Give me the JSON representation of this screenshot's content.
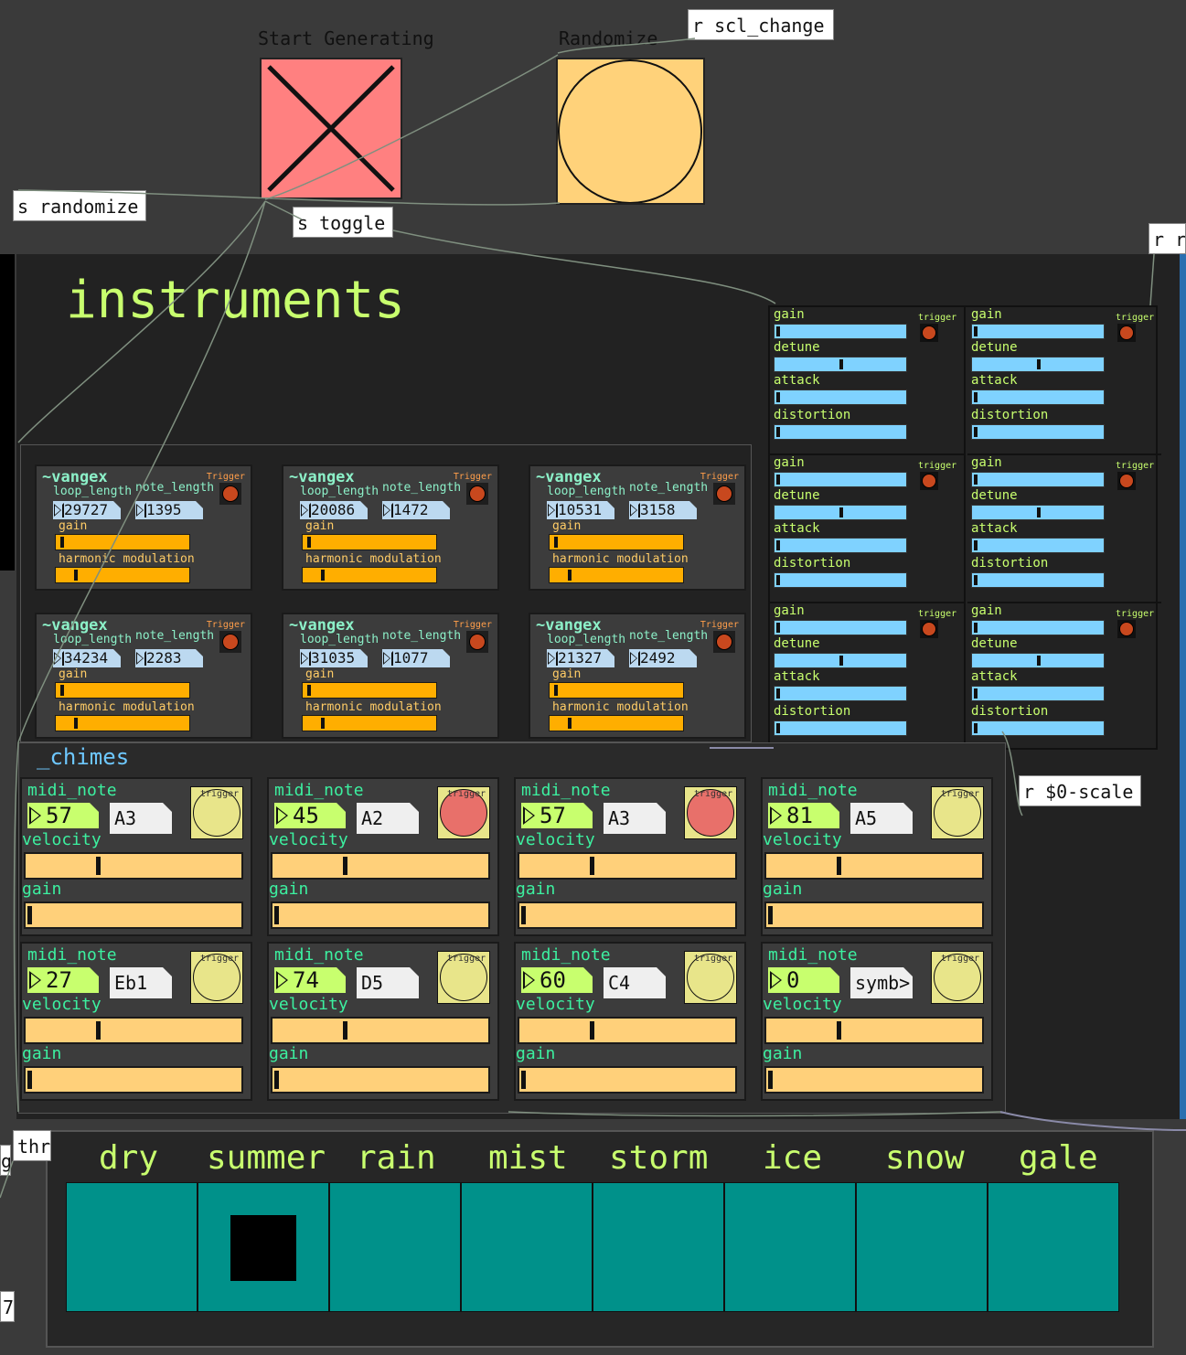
{
  "top": {
    "start_label": "Start Generating",
    "randomize_label": "Randomize",
    "start_toggle_on": true,
    "objects": {
      "scl_change": "r scl_change",
      "randomize_send": "s randomize",
      "toggle_send": "s toggle",
      "r_r": "r r",
      "scale": "r $0-scale",
      "thr": "thr",
      "g": "g",
      "seven": "7"
    },
    "colors": {
      "toggle": "#ff8080",
      "bang": "#ffd27a"
    }
  },
  "instruments": {
    "title": "instruments",
    "vangex": [
      {
        "title": "~vangex",
        "trigger": "Trigger",
        "loop_label": "loop_length",
        "note_label": "note_length",
        "loop_length": "29727",
        "note_length": "1395",
        "gain_label": "gain",
        "hm_label": "harmonic modulation",
        "gain": 0.02,
        "hm": 0.13
      },
      {
        "title": "~vangex",
        "trigger": "Trigger",
        "loop_label": "loop_length",
        "note_label": "note_length",
        "loop_length": "20086",
        "note_length": "1472",
        "gain_label": "gain",
        "hm_label": "harmonic modulation",
        "gain": 0.02,
        "hm": 0.13
      },
      {
        "title": "~vangex",
        "trigger": "Trigger",
        "loop_label": "loop_length",
        "note_label": "note_length",
        "loop_length": "10531",
        "note_length": "3158",
        "gain_label": "gain",
        "hm_label": "harmonic modulation",
        "gain": 0.02,
        "hm": 0.13
      },
      {
        "title": "~vangex",
        "trigger": "Trigger",
        "loop_label": "loop_length",
        "note_label": "note_length",
        "loop_length": "34234",
        "note_length": "2283",
        "gain_label": "gain",
        "hm_label": "harmonic modulation",
        "gain": 0.02,
        "hm": 0.13
      },
      {
        "title": "~vangex",
        "trigger": "Trigger",
        "loop_label": "loop_length",
        "note_label": "note_length",
        "loop_length": "31035",
        "note_length": "1077",
        "gain_label": "gain",
        "hm_label": "harmonic modulation",
        "gain": 0.02,
        "hm": 0.13
      },
      {
        "title": "~vangex",
        "trigger": "Trigger",
        "loop_label": "loop_length",
        "note_label": "note_length",
        "loop_length": "21327",
        "note_length": "2492",
        "gain_label": "gain",
        "hm_label": "harmonic modulation",
        "gain": 0.02,
        "hm": 0.13
      }
    ],
    "synths": [
      {
        "gain_label": "gain",
        "trigger": "trigger",
        "detune_label": "detune",
        "attack_label": "attack",
        "distortion_label": "distortion",
        "gain": 0.0,
        "detune": 0.5,
        "attack": 0.0,
        "distortion": 0.0
      },
      {
        "gain_label": "gain",
        "trigger": "trigger",
        "detune_label": "detune",
        "attack_label": "attack",
        "distortion_label": "distortion",
        "gain": 0.0,
        "detune": 0.5,
        "attack": 0.0,
        "distortion": 0.0
      },
      {
        "gain_label": "gain",
        "trigger": "trigger",
        "detune_label": "detune",
        "attack_label": "attack",
        "distortion_label": "distortion",
        "gain": 0.0,
        "detune": 0.5,
        "attack": 0.0,
        "distortion": 0.0
      },
      {
        "gain_label": "gain",
        "trigger": "trigger",
        "detune_label": "detune",
        "attack_label": "attack",
        "distortion_label": "distortion",
        "gain": 0.0,
        "detune": 0.5,
        "attack": 0.0,
        "distortion": 0.0
      },
      {
        "gain_label": "gain",
        "trigger": "trigger",
        "detune_label": "detune",
        "attack_label": "attack",
        "distortion_label": "distortion",
        "gain": 0.0,
        "detune": 0.5,
        "attack": 0.0,
        "distortion": 0.0
      },
      {
        "gain_label": "gain",
        "trigger": "trigger",
        "detune_label": "detune",
        "attack_label": "attack",
        "distortion_label": "distortion",
        "gain": 0.0,
        "detune": 0.5,
        "attack": 0.0,
        "distortion": 0.0
      }
    ]
  },
  "chimes": {
    "title": "_chimes",
    "items": [
      {
        "midi_label": "midi_note",
        "midi_note": "57",
        "note_name": "A3",
        "trigger": "trigger",
        "active": false,
        "velocity_label": "velocity",
        "gain_label": "gain",
        "velocity": 0.33,
        "gain": 0.0
      },
      {
        "midi_label": "midi_note",
        "midi_note": "45",
        "note_name": "A2",
        "trigger": "trigger",
        "active": true,
        "velocity_label": "velocity",
        "gain_label": "gain",
        "velocity": 0.33,
        "gain": 0.0
      },
      {
        "midi_label": "midi_note",
        "midi_note": "57",
        "note_name": "A3",
        "trigger": "trigger",
        "active": true,
        "velocity_label": "velocity",
        "gain_label": "gain",
        "velocity": 0.33,
        "gain": 0.0
      },
      {
        "midi_label": "midi_note",
        "midi_note": "81",
        "note_name": "A5",
        "trigger": "trigger",
        "active": false,
        "velocity_label": "velocity",
        "gain_label": "gain",
        "velocity": 0.33,
        "gain": 0.0
      },
      {
        "midi_label": "midi_note",
        "midi_note": "27",
        "note_name": "Eb1",
        "trigger": "trigger",
        "active": false,
        "velocity_label": "velocity",
        "gain_label": "gain",
        "velocity": 0.33,
        "gain": 0.0
      },
      {
        "midi_label": "midi_note",
        "midi_note": "74",
        "note_name": "D5",
        "trigger": "trigger",
        "active": false,
        "velocity_label": "velocity",
        "gain_label": "gain",
        "velocity": 0.33,
        "gain": 0.0
      },
      {
        "midi_label": "midi_note",
        "midi_note": "60",
        "note_name": "C4",
        "trigger": "trigger",
        "active": false,
        "velocity_label": "velocity",
        "gain_label": "gain",
        "velocity": 0.33,
        "gain": 0.0
      },
      {
        "midi_label": "midi_note",
        "midi_note": "0",
        "note_name": "symb>",
        "trigger": "trigger",
        "active": false,
        "velocity_label": "velocity",
        "gain_label": "gain",
        "velocity": 0.33,
        "gain": 0.0
      }
    ]
  },
  "weather": {
    "options": [
      "dry",
      "summer",
      "rain",
      "mist",
      "storm",
      "ice",
      "snow",
      "gale"
    ],
    "selected_index": 1
  }
}
